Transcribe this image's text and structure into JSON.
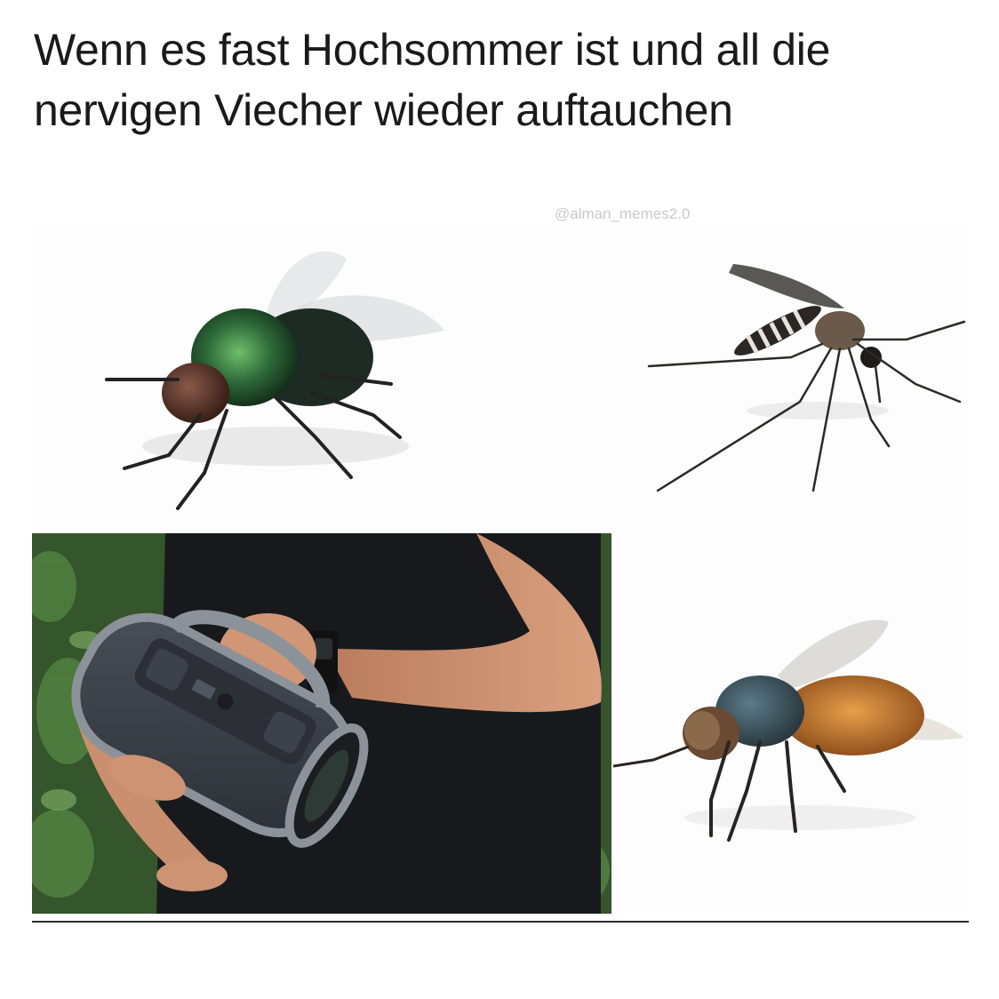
{
  "caption": {
    "line1": "Wenn es fast Hochsommer ist und all die",
    "line2": "nervigen Viecher wieder auftauchen"
  },
  "watermark": "@alman_memes2.0",
  "panels": [
    {
      "subject": "green-fly-icon"
    },
    {
      "subject": "mosquito-icon"
    },
    {
      "subject": "speaker-icon"
    },
    {
      "subject": "horsefly-icon"
    }
  ],
  "colors": {
    "background": "#ffffff",
    "text": "#1a1a1a",
    "watermark": "#c9c9c9",
    "speaker_body": "#3b4048",
    "speaker_trim": "#8c9299",
    "shirt": "#15171b",
    "skin": "#c98f6f",
    "foliage": "#3f6b35",
    "fly_green": "#2e6a3a",
    "horsefly_orange": "#c8732b"
  }
}
